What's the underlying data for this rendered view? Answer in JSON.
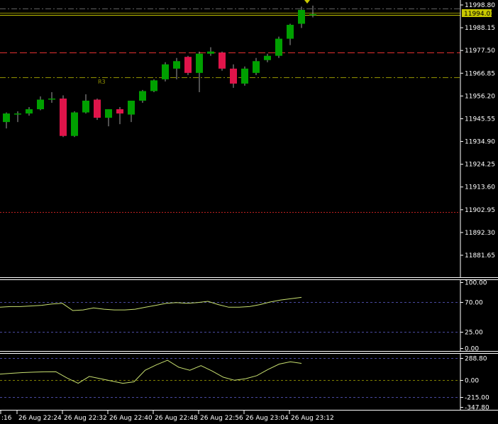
{
  "colors": {
    "background": "#000000",
    "bull": "#00a000",
    "bear": "#e0144a",
    "price_line": "#c8c800",
    "resistance_line": "#e03030",
    "pivot_line": "#909000",
    "support_line": "#c02020",
    "indicator_line": "#c8e070",
    "level_line": "#4a4aa0",
    "zero_line": "#808000",
    "axis_text": "#ffffff",
    "separator": "#ffffff"
  },
  "price_axis": {
    "ticks": [
      "11998.80",
      "11988.15",
      "11977.50",
      "11966.85",
      "11956.20",
      "11945.55",
      "11934.90",
      "11924.25",
      "11913.60",
      "11902.95",
      "11892.30",
      "11881.65"
    ],
    "current_price": "11994.03"
  },
  "time_axis": {
    "labels": [
      ":16",
      "26 Aug 22:24",
      "26 Aug 22:32",
      "26 Aug 22:40",
      "26 Aug 22:48",
      "26 Aug 22:56",
      "26 Aug 23:04",
      "26 Aug 23:12"
    ]
  },
  "level_tags": {
    "r3": "R3"
  },
  "indicator1": {
    "levels": [
      "100.00",
      "70.00",
      "25.00",
      "0.00"
    ],
    "values": [
      62,
      63,
      63,
      64,
      65,
      67,
      68,
      57,
      58,
      61,
      59,
      58,
      58,
      59,
      62,
      65,
      68,
      69,
      68,
      69,
      71,
      66,
      62,
      62,
      63,
      66,
      70,
      73,
      75,
      77
    ]
  },
  "indicator2": {
    "levels": [
      "288.80",
      "0.00",
      "-215.00",
      "-347.80"
    ],
    "values": [
      80,
      90,
      100,
      105,
      110,
      112,
      30,
      -40,
      50,
      20,
      -10,
      -40,
      -20,
      130,
      200,
      260,
      170,
      130,
      190,
      120,
      40,
      0,
      20,
      60,
      140,
      210,
      240,
      220
    ]
  },
  "chart_data": {
    "type": "candlestick",
    "symbol_price": "11994.03",
    "ylim": [
      11875,
      12003
    ],
    "candles": [
      {
        "o": 11944.0,
        "h": 11948.5,
        "l": 11941.0,
        "c": 11948.0
      },
      {
        "o": 11947.5,
        "h": 11949.0,
        "l": 11944.0,
        "c": 11948.0
      },
      {
        "o": 11948.0,
        "h": 11951.0,
        "l": 11947.0,
        "c": 11950.0
      },
      {
        "o": 11950.0,
        "h": 11956.0,
        "l": 11949.5,
        "c": 11954.5
      },
      {
        "o": 11954.5,
        "h": 11958.0,
        "l": 11953.0,
        "c": 11955.0
      },
      {
        "o": 11955.0,
        "h": 11956.5,
        "l": 11937.0,
        "c": 11937.5
      },
      {
        "o": 11937.5,
        "h": 11949.0,
        "l": 11937.0,
        "c": 11948.5
      },
      {
        "o": 11948.5,
        "h": 11957.0,
        "l": 11948.0,
        "c": 11954.0
      },
      {
        "o": 11954.5,
        "h": 11955.0,
        "l": 11945.0,
        "c": 11946.0
      },
      {
        "o": 11946.0,
        "h": 11950.0,
        "l": 11942.0,
        "c": 11950.0
      },
      {
        "o": 11950.0,
        "h": 11951.0,
        "l": 11943.0,
        "c": 11948.0
      },
      {
        "o": 11947.5,
        "h": 11954.0,
        "l": 11944.0,
        "c": 11954.0
      },
      {
        "o": 11954.0,
        "h": 11959.0,
        "l": 11953.0,
        "c": 11958.5
      },
      {
        "o": 11958.5,
        "h": 11964.0,
        "l": 11958.0,
        "c": 11963.5
      },
      {
        "o": 11964.0,
        "h": 11972.0,
        "l": 11963.0,
        "c": 11971.0
      },
      {
        "o": 11969.0,
        "h": 11974.0,
        "l": 11964.0,
        "c": 11972.5
      },
      {
        "o": 11974.5,
        "h": 11975.0,
        "l": 11966.0,
        "c": 11967.0
      },
      {
        "o": 11967.0,
        "h": 11977.0,
        "l": 11958.0,
        "c": 11976.0
      },
      {
        "o": 11976.0,
        "h": 11979.0,
        "l": 11975.0,
        "c": 11977.0
      },
      {
        "o": 11976.5,
        "h": 11977.0,
        "l": 11968.0,
        "c": 11969.0
      },
      {
        "o": 11969.0,
        "h": 11971.0,
        "l": 11960.0,
        "c": 11962.0
      },
      {
        "o": 11962.0,
        "h": 11970.0,
        "l": 11961.0,
        "c": 11969.0
      },
      {
        "o": 11967.0,
        "h": 11974.0,
        "l": 11966.0,
        "c": 11972.5
      },
      {
        "o": 11973.0,
        "h": 11976.0,
        "l": 11972.0,
        "c": 11975.0
      },
      {
        "o": 11975.0,
        "h": 11984.0,
        "l": 11974.0,
        "c": 11983.0
      },
      {
        "o": 11983.0,
        "h": 11990.0,
        "l": 11980.0,
        "c": 11989.5
      },
      {
        "o": 11990.0,
        "h": 11998.0,
        "l": 11988.0,
        "c": 11996.5
      },
      {
        "o": 11994.0,
        "h": 11998.5,
        "l": 11993.0,
        "c": 11994.5
      }
    ],
    "lines": [
      {
        "price": 11994.03,
        "style": "price"
      },
      {
        "price": 11995.2,
        "style": "pivot"
      },
      {
        "price": 11997.3,
        "style": "dash-dot"
      },
      {
        "price": 11976.6,
        "style": "resistance"
      },
      {
        "price": 11965.1,
        "style": "r3"
      },
      {
        "price": 11902.0,
        "style": "support"
      }
    ]
  }
}
